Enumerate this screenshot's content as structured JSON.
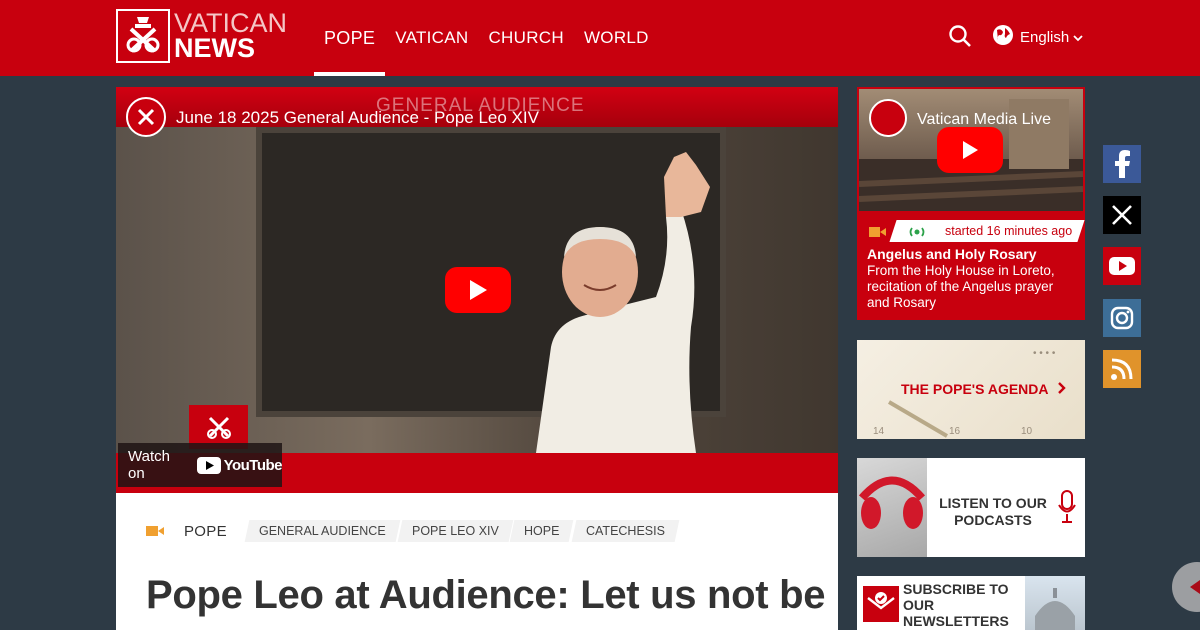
{
  "header": {
    "logo_line1": "VATICAN",
    "logo_line2": "NEWS",
    "nav": [
      "POPE",
      "VATICAN",
      "CHURCH",
      "WORLD"
    ],
    "active_nav": "POPE",
    "language": "English",
    "icons": [
      "logo-emblem-icon",
      "search-icon",
      "globe-icon",
      "chevron-down-icon"
    ]
  },
  "video": {
    "title": "June 18 2025 General Audience - Pope Leo XIV",
    "overlay_text": "GENERAL AUDIENCE",
    "watch_on": "Watch on",
    "youtube": "YouTube"
  },
  "article": {
    "section": "POPE",
    "tags": [
      "GENERAL AUDIENCE",
      "POPE LEO XIV",
      "HOPE",
      "CATECHESIS"
    ],
    "headline": "Pope Leo at Audience: Let us not be"
  },
  "live": {
    "title": "Vatican Media Live",
    "started": "started 16 minutes ago",
    "heading": "Angelus and Holy Rosary",
    "description": "From the Holy House in Loreto, recitation of the Angelus prayer and Rosary"
  },
  "agenda": {
    "label": "THE POPE'S AGENDA"
  },
  "podcasts": {
    "label": "LISTEN TO OUR PODCASTS"
  },
  "newsletter": {
    "label": "SUBSCRIBE TO OUR NEWSLETTERS"
  },
  "social": [
    "facebook-icon",
    "x-icon",
    "youtube-icon",
    "instagram-icon",
    "rss-icon"
  ],
  "colors": {
    "brand_red": "#c8000e",
    "background": "#2d3a45"
  }
}
